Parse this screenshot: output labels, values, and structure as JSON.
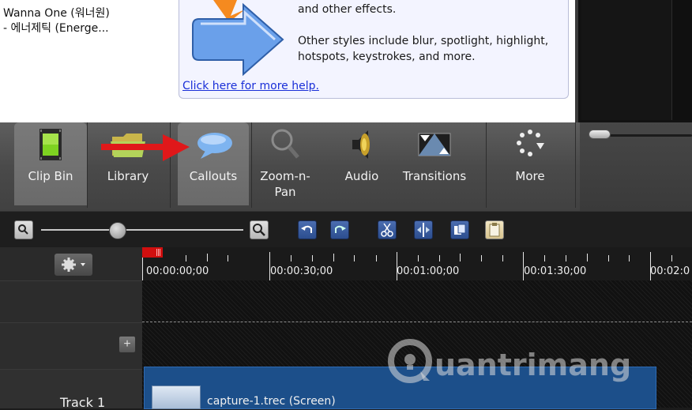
{
  "clip_bin": {
    "item_title": "Wanna One (워너원)\n- 에너제틱 (Energe..."
  },
  "help": {
    "text_1": "and other effects.",
    "text_2": "Other styles include blur, spotlight, highlight, hotspots, keystrokes, and more.",
    "link": "Click here for more help."
  },
  "tabs": [
    {
      "label": "Clip Bin",
      "icon": "film-icon"
    },
    {
      "label": "Library",
      "icon": "folder-icon"
    },
    {
      "label": "Callouts",
      "icon": "speech-bubble-icon"
    },
    {
      "label": "Zoom-n-\nPan",
      "icon": "magnifier-icon"
    },
    {
      "label": "Audio",
      "icon": "speaker-icon"
    },
    {
      "label": "Transitions",
      "icon": "transition-icon"
    },
    {
      "label": "More",
      "icon": "more-icon"
    }
  ],
  "timeline": {
    "ruler_labels": [
      "00:00:00;00",
      "00:00:30;00",
      "00:01:00;00",
      "00:01:30;00",
      "00:02:0"
    ],
    "track_name": "Track 1",
    "clip_label": "capture-1.trec (Screen)"
  },
  "watermark": "uantrimang",
  "colors": {
    "accent": "#d10f0f",
    "toolbar_button": "#3a5fa6",
    "clip": "#1c4f8a"
  }
}
